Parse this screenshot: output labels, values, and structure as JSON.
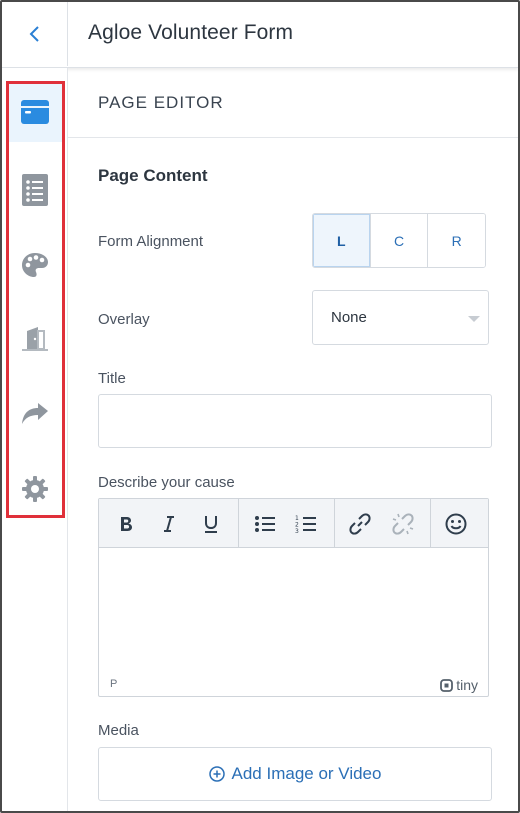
{
  "header": {
    "title": "Agloe Volunteer Form",
    "back_icon": "chevron-left-icon"
  },
  "sidebar": {
    "items": [
      {
        "name": "page-layout",
        "icon": "browser-window-icon",
        "active": true
      },
      {
        "name": "form-fields",
        "icon": "list-icon",
        "active": false
      },
      {
        "name": "theme",
        "icon": "palette-icon",
        "active": false
      },
      {
        "name": "confirmation",
        "icon": "door-exit-icon",
        "active": false
      },
      {
        "name": "share",
        "icon": "share-arrow-icon",
        "active": false
      },
      {
        "name": "settings",
        "icon": "gear-icon",
        "active": false
      }
    ],
    "highlight_color": "#e0303a"
  },
  "editor_panel": {
    "title": "PAGE EDITOR",
    "section_title": "Page Content",
    "form_alignment": {
      "label": "Form Alignment",
      "options": [
        "L",
        "C",
        "R"
      ],
      "selected": "L"
    },
    "overlay": {
      "label": "Overlay",
      "value": "None"
    },
    "title_field": {
      "label": "Title",
      "value": ""
    },
    "cause": {
      "label": "Describe your cause",
      "toolbar": [
        "bold",
        "italic",
        "underline",
        "bullet-list",
        "numbered-list",
        "link",
        "unlink",
        "emoji"
      ],
      "status_path": "P",
      "brand": "tiny"
    },
    "media": {
      "label": "Media",
      "button_label": "Add Image or Video"
    }
  },
  "colors": {
    "accent": "#2b6fb6",
    "icon_active": "#2a8be0",
    "icon_inactive": "#8f969e"
  }
}
